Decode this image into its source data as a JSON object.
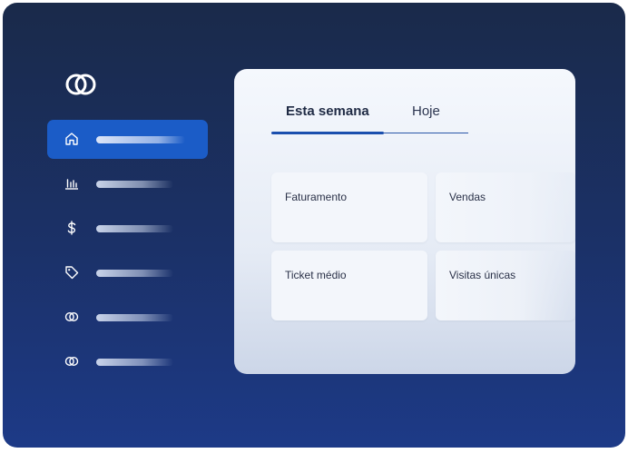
{
  "sidebar": {
    "logo_icon": "interlocked-circles-icon",
    "items": [
      {
        "icon": "home-icon",
        "active": true
      },
      {
        "icon": "bar-chart-icon",
        "active": false
      },
      {
        "icon": "dollar-icon",
        "active": false
      },
      {
        "icon": "tag-icon",
        "active": false
      },
      {
        "icon": "interlocked-circles-icon",
        "active": false
      },
      {
        "icon": "interlocked-circles-icon",
        "active": false
      }
    ],
    "active_color": "#1b5cc7"
  },
  "panel": {
    "tabs": [
      {
        "label": "Esta semana",
        "selected": true
      },
      {
        "label": "Hoje",
        "selected": false
      }
    ],
    "cards": [
      {
        "label": "Faturamento"
      },
      {
        "label": "Vendas"
      },
      {
        "label": "Ticket médio"
      },
      {
        "label": "Visitas únicas"
      }
    ]
  },
  "colors": {
    "background_top": "#1a2a4a",
    "background_bottom": "#1d3a87",
    "accent": "#1b4fae"
  }
}
